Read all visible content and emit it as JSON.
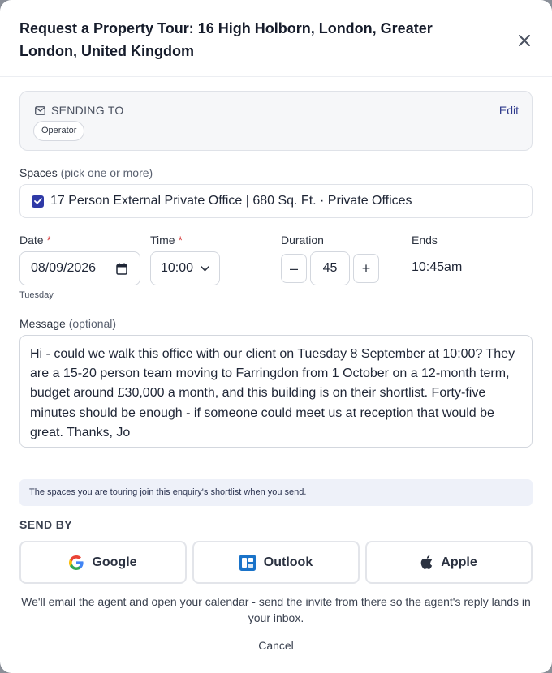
{
  "dialog": {
    "title": "Request a Property Tour: 16 High Holborn, London, Greater London, United Kingdom"
  },
  "sending": {
    "heading": "SENDING TO",
    "edit_label": "Edit",
    "recipient_chip": "Operator"
  },
  "spaces": {
    "label": "Spaces",
    "hint": "(pick one or more)",
    "items": [
      {
        "label": "17 Person External Private Office | 680 Sq. Ft. · Private Offices",
        "checked": true
      }
    ]
  },
  "schedule": {
    "date_label": "Date",
    "date_value": "08/09/2026",
    "weekday": "Tuesday",
    "time_label": "Time",
    "time_value": "10:00",
    "required_mark": "*",
    "duration_label": "Duration",
    "duration_value": "45",
    "decrement_label": "–",
    "increment_label": "+",
    "ends_label": "Ends",
    "ends_value": "10:45am"
  },
  "message": {
    "label": "Message",
    "hint": "(optional)",
    "value": "Hi - could we walk this office with our client on Tuesday 8 September at 10:00? They are a 15-20 person team moving to Farringdon from 1 October on a 12-month term, budget around £30,000 a month, and this building is on their shortlist. Forty-five minutes should be enough - if someone could meet us at reception that would be great. Thanks, Jo"
  },
  "info_note": "The spaces you are touring join this enquiry's shortlist when you send.",
  "send_by": {
    "heading": "SEND BY",
    "options": [
      {
        "label": "Google",
        "icon": "google-icon"
      },
      {
        "label": "Outlook",
        "icon": "outlook-icon"
      },
      {
        "label": "Apple",
        "icon": "apple-icon"
      }
    ]
  },
  "footnote": "We'll email the agent and open your calendar - send the invite from there so the agent's reply lands in your inbox.",
  "cancel_label": "Cancel",
  "colors": {
    "accent": "#2f3aa7",
    "required": "#d63b3b",
    "info_bg": "#eef1f9"
  }
}
